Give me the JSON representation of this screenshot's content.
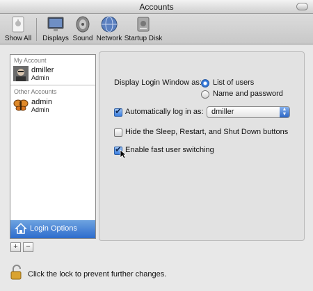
{
  "window": {
    "title": "Accounts"
  },
  "toolbar": {
    "items": [
      {
        "label": "Show All",
        "icon": "apple-grid-icon"
      },
      {
        "label": "Displays",
        "icon": "display-icon"
      },
      {
        "label": "Sound",
        "icon": "speaker-icon"
      },
      {
        "label": "Network",
        "icon": "globe-icon"
      },
      {
        "label": "Startup Disk",
        "icon": "disk-icon"
      }
    ]
  },
  "sidebar": {
    "my_account_label": "My Account",
    "other_accounts_label": "Other Accounts",
    "my_account": {
      "name": "dmiller",
      "role": "Admin"
    },
    "other_accounts": [
      {
        "name": "admin",
        "role": "Admin"
      }
    ],
    "login_options_label": "Login Options",
    "add_button": "+",
    "remove_button": "−"
  },
  "login_options": {
    "display_login_label": "Display Login Window as:",
    "display_options": [
      "List of users",
      "Name and password"
    ],
    "display_selected": "List of users",
    "auto_login_label": "Automatically log in as:",
    "auto_login_checked": true,
    "auto_login_user": "dmiller",
    "hide_buttons_label": "Hide the Sleep, Restart, and Shut Down buttons",
    "hide_buttons_checked": false,
    "fast_switching_label": "Enable fast user switching",
    "fast_switching_checked": true
  },
  "footer": {
    "lock_text": "Click the lock to prevent further changes."
  },
  "colors": {
    "accent": "#2d6ccd",
    "window_bg": "#e8e8e8"
  }
}
